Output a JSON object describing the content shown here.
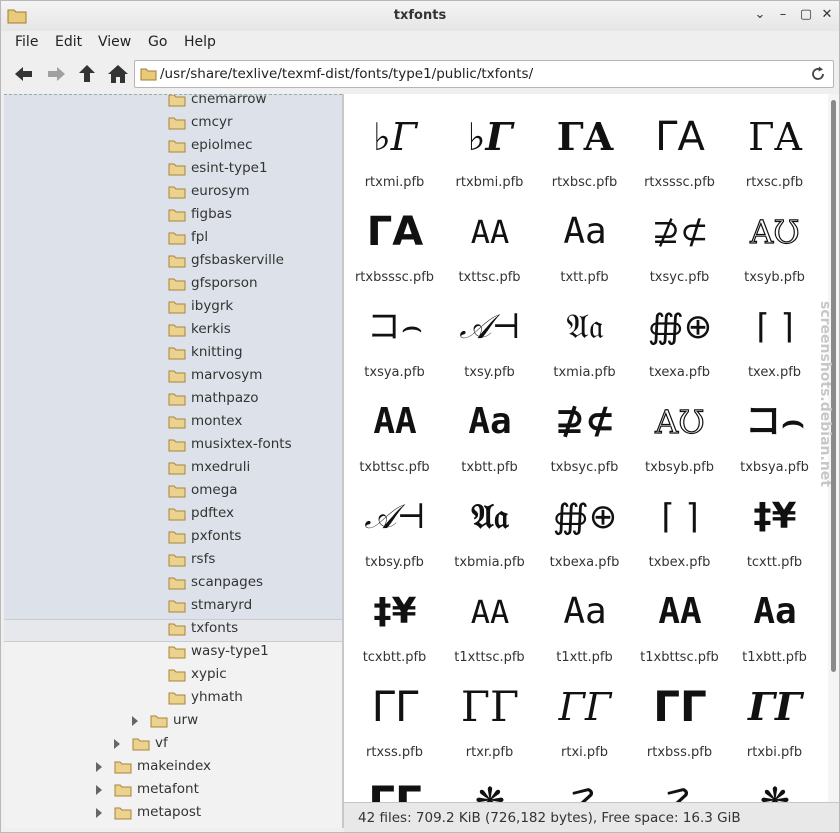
{
  "window": {
    "title": "txfonts"
  },
  "menu": [
    "File",
    "Edit",
    "View",
    "Go",
    "Help"
  ],
  "toolbar": {
    "back_icon": "arrow-left-icon",
    "forward_icon": "arrow-right-icon",
    "up_icon": "arrow-up-icon",
    "home_icon": "home-icon",
    "location": "/usr/share/texlive/texmf-dist/fonts/type1/public/txfonts/",
    "reload_icon": "reload-icon"
  },
  "tree": [
    {
      "label": "chemarrow",
      "level": 3
    },
    {
      "label": "cmcyr",
      "level": 3
    },
    {
      "label": "epiolmec",
      "level": 3
    },
    {
      "label": "esint-type1",
      "level": 3
    },
    {
      "label": "eurosym",
      "level": 3
    },
    {
      "label": "figbas",
      "level": 3
    },
    {
      "label": "fpl",
      "level": 3
    },
    {
      "label": "gfsbaskerville",
      "level": 3
    },
    {
      "label": "gfsporson",
      "level": 3
    },
    {
      "label": "ibygrk",
      "level": 3
    },
    {
      "label": "kerkis",
      "level": 3
    },
    {
      "label": "knitting",
      "level": 3
    },
    {
      "label": "marvosym",
      "level": 3
    },
    {
      "label": "mathpazo",
      "level": 3
    },
    {
      "label": "montex",
      "level": 3
    },
    {
      "label": "musixtex-fonts",
      "level": 3
    },
    {
      "label": "mxedruli",
      "level": 3
    },
    {
      "label": "omega",
      "level": 3
    },
    {
      "label": "pdftex",
      "level": 3
    },
    {
      "label": "pxfonts",
      "level": 3
    },
    {
      "label": "rsfs",
      "level": 3
    },
    {
      "label": "scanpages",
      "level": 3
    },
    {
      "label": "stmaryrd",
      "level": 3
    },
    {
      "label": "txfonts",
      "level": 3,
      "selected": true
    },
    {
      "label": "wasy-type1",
      "level": 3
    },
    {
      "label": "xypic",
      "level": 3
    },
    {
      "label": "yhmath",
      "level": 3
    },
    {
      "label": "urw",
      "level": 2,
      "expander": true
    },
    {
      "label": "vf",
      "level": 1,
      "expander": true
    },
    {
      "label": "makeindex",
      "level": 0,
      "expander": true
    },
    {
      "label": "metafont",
      "level": 0,
      "expander": true
    },
    {
      "label": "metapost",
      "level": 0,
      "expander": true
    }
  ],
  "files": [
    {
      "name": "rtxmi.pfb",
      "glyphs": "♭Γ",
      "style": "italic-light"
    },
    {
      "name": "rtxbmi.pfb",
      "glyphs": "♭Γ",
      "style": "italic-bold"
    },
    {
      "name": "rtxbsc.pfb",
      "glyphs": "ΓA",
      "style": "sc-bold"
    },
    {
      "name": "rtxsssc.pfb",
      "glyphs": "ΓA",
      "style": "sc-sans"
    },
    {
      "name": "rtxsc.pfb",
      "glyphs": "ΓA",
      "style": "sc"
    },
    {
      "name": "rtxbsssc.pfb",
      "glyphs": "ΓA",
      "style": "sc-sansbold"
    },
    {
      "name": "txttsc.pfb",
      "glyphs": "AA",
      "style": "mono-sc"
    },
    {
      "name": "txtt.pfb",
      "glyphs": "Aa",
      "style": "mono"
    },
    {
      "name": "txsyc.pfb",
      "glyphs": "⊉⊄",
      "style": "sym"
    },
    {
      "name": "txsyb.pfb",
      "glyphs": "AƱ",
      "style": "outline"
    },
    {
      "name": "txsya.pfb",
      "glyphs": "コ⌢",
      "style": "sym"
    },
    {
      "name": "txsy.pfb",
      "glyphs": "𝒜⊣",
      "style": "script"
    },
    {
      "name": "txmia.pfb",
      "glyphs": "𝔄𝔞",
      "style": "fraktur"
    },
    {
      "name": "txexa.pfb",
      "glyphs": "∰⊕",
      "style": "sym-cut"
    },
    {
      "name": "txex.pfb",
      "glyphs": "⌈ ⌉",
      "style": "sym-cut"
    },
    {
      "name": "txbttsc.pfb",
      "glyphs": "AA",
      "style": "mono-bold"
    },
    {
      "name": "txbtt.pfb",
      "glyphs": "Aa",
      "style": "mono-bold"
    },
    {
      "name": "txbsyc.pfb",
      "glyphs": "⊉⊄",
      "style": "sym-bold"
    },
    {
      "name": "txbsyb.pfb",
      "glyphs": "AƱ",
      "style": "outline"
    },
    {
      "name": "txbsya.pfb",
      "glyphs": "コ⌢",
      "style": "sym-bold"
    },
    {
      "name": "txbsy.pfb",
      "glyphs": "𝒜⊣",
      "style": "script"
    },
    {
      "name": "txbmia.pfb",
      "glyphs": "𝔄𝔞",
      "style": "fraktur-bold"
    },
    {
      "name": "txbexa.pfb",
      "glyphs": "∰⊕",
      "style": "sym-cut"
    },
    {
      "name": "txbex.pfb",
      "glyphs": "⌈ ⌉",
      "style": "sym-cut"
    },
    {
      "name": "tcxtt.pfb",
      "glyphs": "‡¥",
      "style": "sym-bold"
    },
    {
      "name": "tcxbtt.pfb",
      "glyphs": "‡¥",
      "style": "sym-bold"
    },
    {
      "name": "t1xttsc.pfb",
      "glyphs": "AA",
      "style": "mono-sc"
    },
    {
      "name": "t1xtt.pfb",
      "glyphs": "Aa",
      "style": "mono"
    },
    {
      "name": "t1xbttsc.pfb",
      "glyphs": "AA",
      "style": "mono-bold"
    },
    {
      "name": "t1xbtt.pfb",
      "glyphs": "Aa",
      "style": "mono-bold"
    },
    {
      "name": "rtxss.pfb",
      "glyphs": "ΓΓ",
      "style": "sans"
    },
    {
      "name": "rtxr.pfb",
      "glyphs": "ΓΓ",
      "style": "serif"
    },
    {
      "name": "rtxi.pfb",
      "glyphs": "ΓΓ",
      "style": "italic-light"
    },
    {
      "name": "rtxbss.pfb",
      "glyphs": "ΓΓ",
      "style": "sans-bold"
    },
    {
      "name": "rtxbi.pfb",
      "glyphs": "ΓΓ",
      "style": "italic-bold"
    },
    {
      "name": "",
      "glyphs": "ΓΓ",
      "style": "sans-bold"
    },
    {
      "name": "",
      "glyphs": "❋",
      "style": "sym-bold"
    },
    {
      "name": "",
      "glyphs": "☡",
      "style": "sym"
    },
    {
      "name": "",
      "glyphs": "☡",
      "style": "sym"
    },
    {
      "name": "",
      "glyphs": "❋",
      "style": "sym-bold"
    }
  ],
  "status": "42 files: 709.2  KiB (726,182 bytes), Free space: 16.3  GiB",
  "watermark": "screenshots.debian.net"
}
